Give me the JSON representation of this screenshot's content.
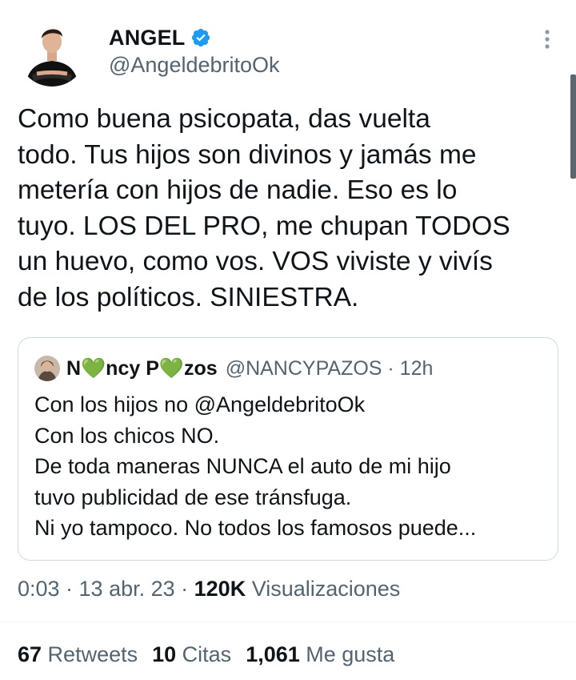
{
  "author": {
    "display_name": "ANGEL",
    "handle": "@AngeldebritoOk",
    "verified_icon": "verified-badge-icon",
    "verified_color": "#1d9bf0"
  },
  "tweet": {
    "text": "Como buena psicopata, das vuelta\ntodo. Tus hijos son divinos y jamás me\nmetería con hijos de nadie. Eso es lo\ntuyo. LOS DEL PRO, me chupan TODOS\nun huevo, como vos. VOS viviste y vivís\nde los políticos. SINIESTRA."
  },
  "quoted_tweet": {
    "display_name": "N💚ncy P💚zos",
    "handle_time": "@NANCYPAZOS · 12h",
    "text": "Con los hijos no @AngeldebritoOk\nCon los chicos NO.\nDe toda maneras NUNCA el auto de mi hijo\ntuvo publicidad de ese tránsfuga.\nNi yo tampoco. No todos los famosos puede..."
  },
  "meta": {
    "time_date": "0:03 · 13 abr. 23 · ",
    "views_count": "120K",
    "views_label": " Visualizaciones"
  },
  "stats": {
    "retweets_count": "67",
    "retweets_label": " Retweets",
    "quotes_count": "10",
    "quotes_label": " Citas",
    "likes_count": "1,061",
    "likes_label": " Me gusta"
  },
  "colors": {
    "text_primary": "#0f1419",
    "text_secondary": "#536471",
    "border": "#cfd9de",
    "heart_green": "#78b159"
  }
}
